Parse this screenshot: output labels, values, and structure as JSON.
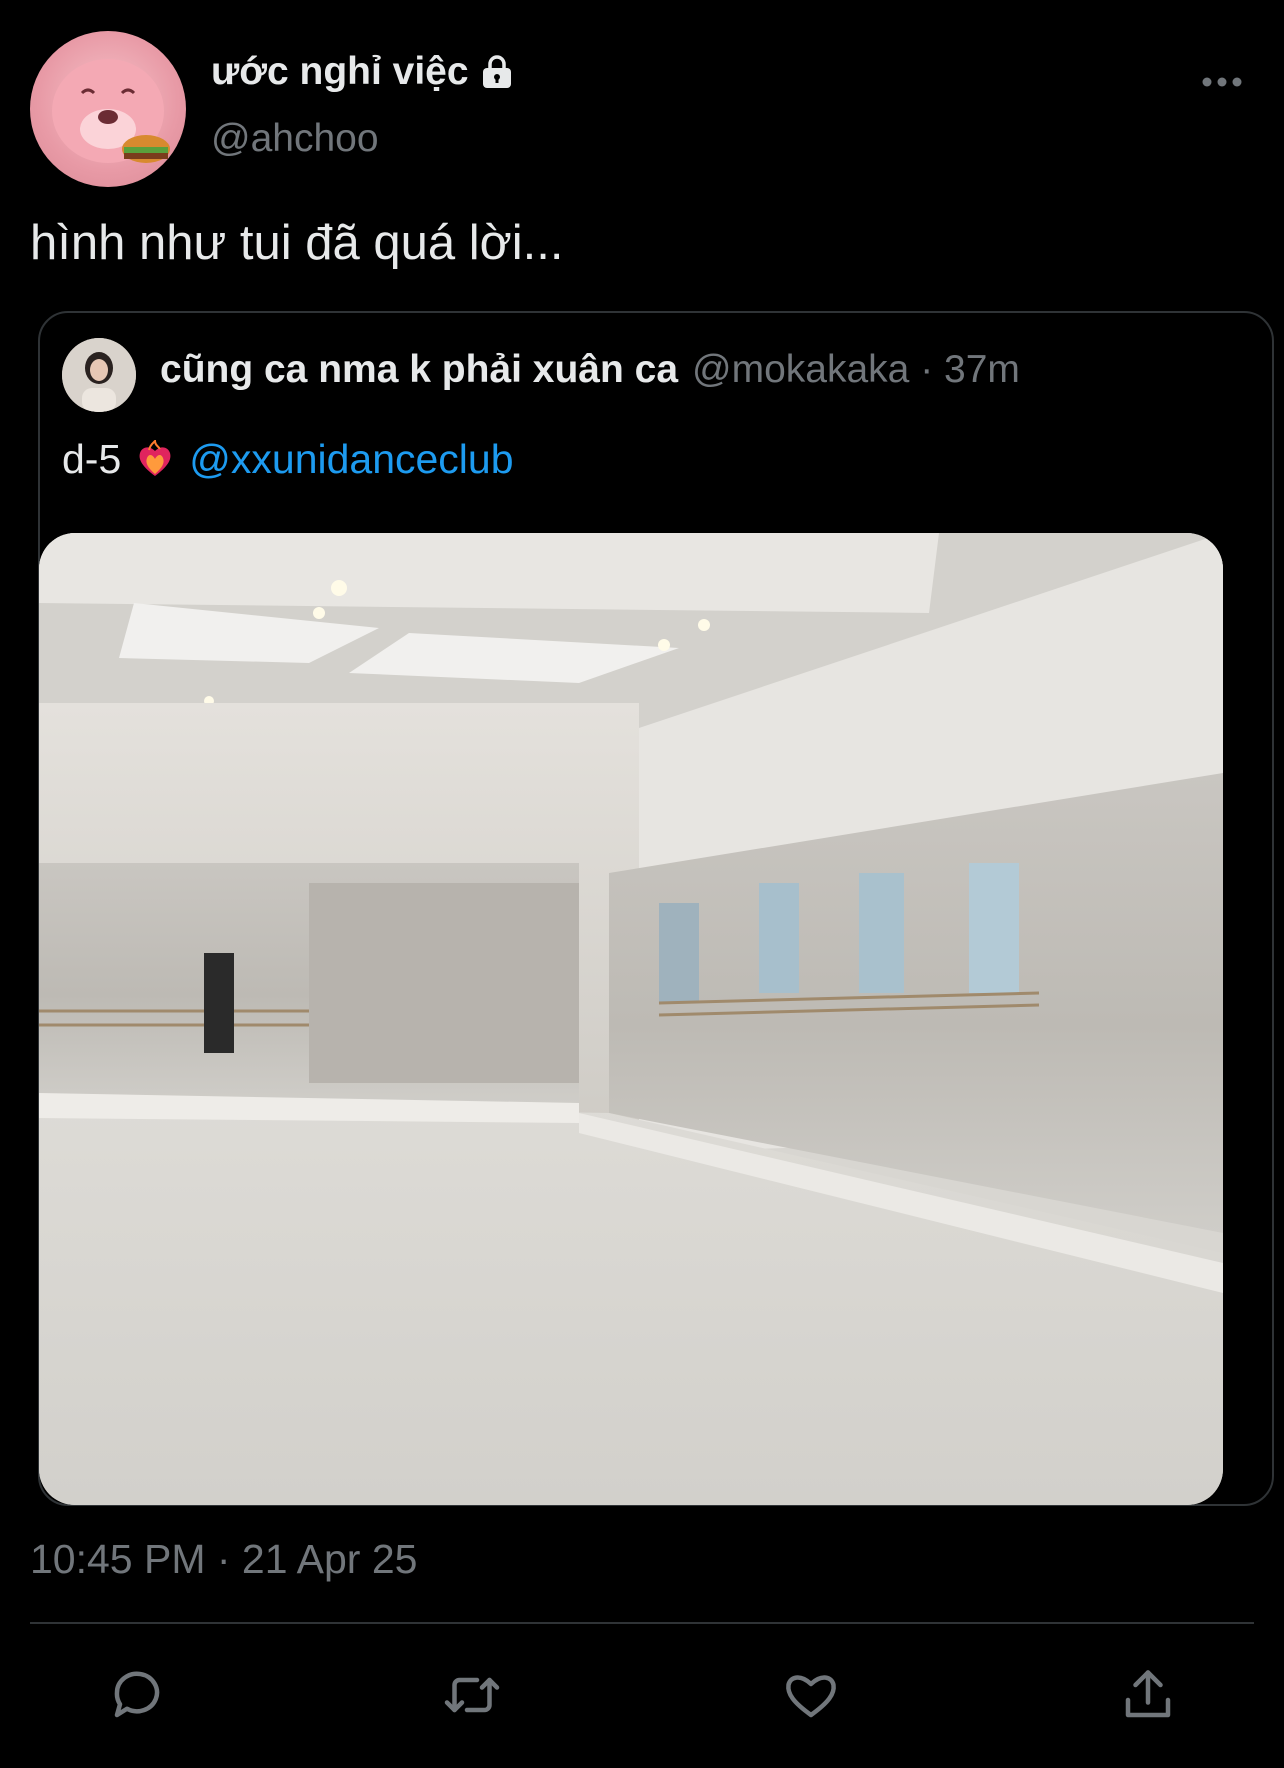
{
  "tweet": {
    "display_name": "ước nghỉ việc",
    "handle": "@ahchoo",
    "text": "hình như tui đã quá lời...",
    "timestamp": "10:45 PM · 21 Apr 25",
    "icons": {
      "avatar": "avatar-pink-beaver",
      "lock": "lock-icon",
      "more": "more-dots-icon"
    }
  },
  "quote": {
    "display_name": "cũng ca nma k phải xuân ca",
    "meta": "@mokakaka · 37m",
    "text_prefix": "d-5",
    "emoji": "heart-on-fire",
    "mention": "@xxunidanceclub",
    "image": "dance-studio-with-mirrors"
  },
  "actions": [
    {
      "name": "reply",
      "icon": "reply-icon"
    },
    {
      "name": "retweet",
      "icon": "retweet-icon"
    },
    {
      "name": "like",
      "icon": "heart-icon"
    },
    {
      "name": "share",
      "icon": "share-icon"
    }
  ],
  "colors": {
    "background": "#000000",
    "primary_text": "#e7e9ea",
    "secondary_text": "#71767b",
    "link": "#1d9bf0",
    "border": "#2f3336"
  }
}
